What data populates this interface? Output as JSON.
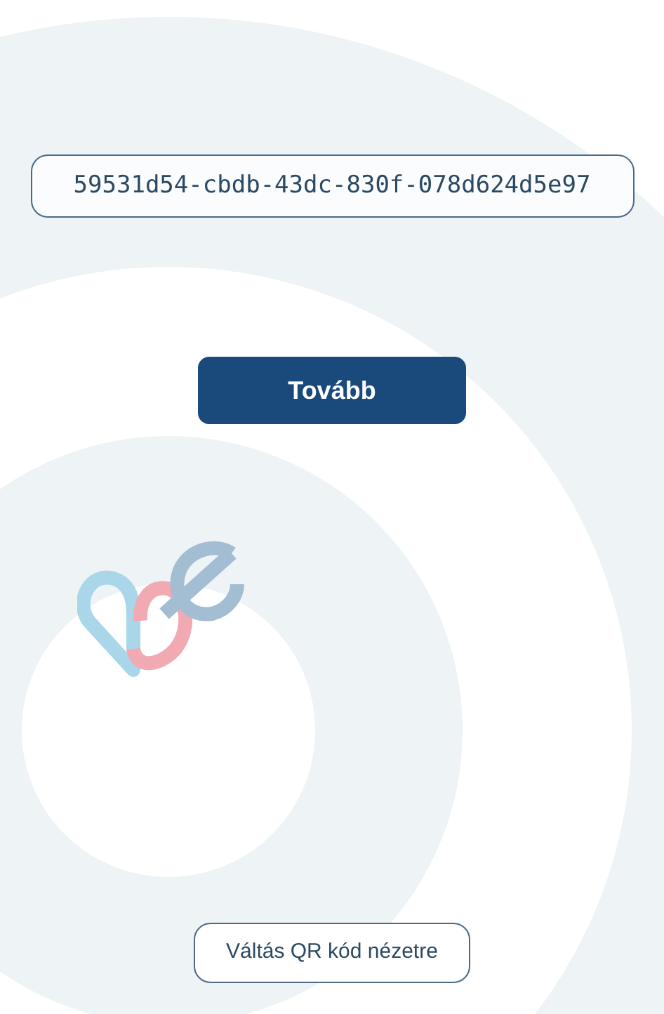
{
  "code_field": {
    "value": "59531d54-cbdb-43dc-830f-078d624d5e97"
  },
  "next_button": {
    "label": "Tovább"
  },
  "switch_button": {
    "label": "Váltás QR kód nézetre"
  }
}
